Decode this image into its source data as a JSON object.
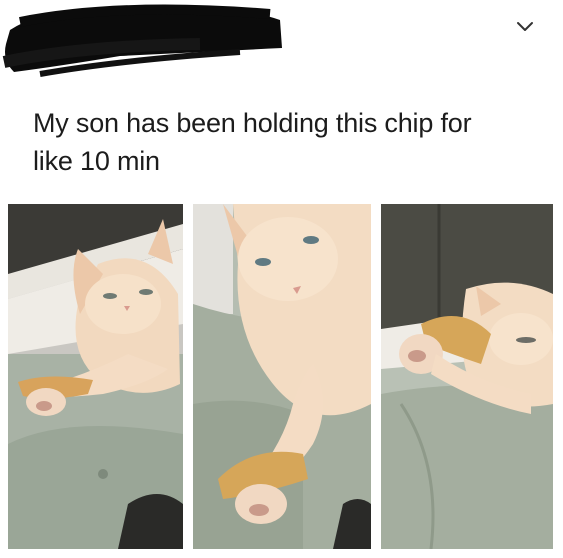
{
  "post": {
    "author_redacted": true,
    "menu_icon": "chevron-down-icon",
    "text_line1": "My son has been holding this chip for",
    "text_line2": "like 10 min"
  },
  "photos": [
    {
      "alt": "cat-photo-1"
    },
    {
      "alt": "cat-photo-2"
    },
    {
      "alt": "cat-photo-3"
    }
  ]
}
